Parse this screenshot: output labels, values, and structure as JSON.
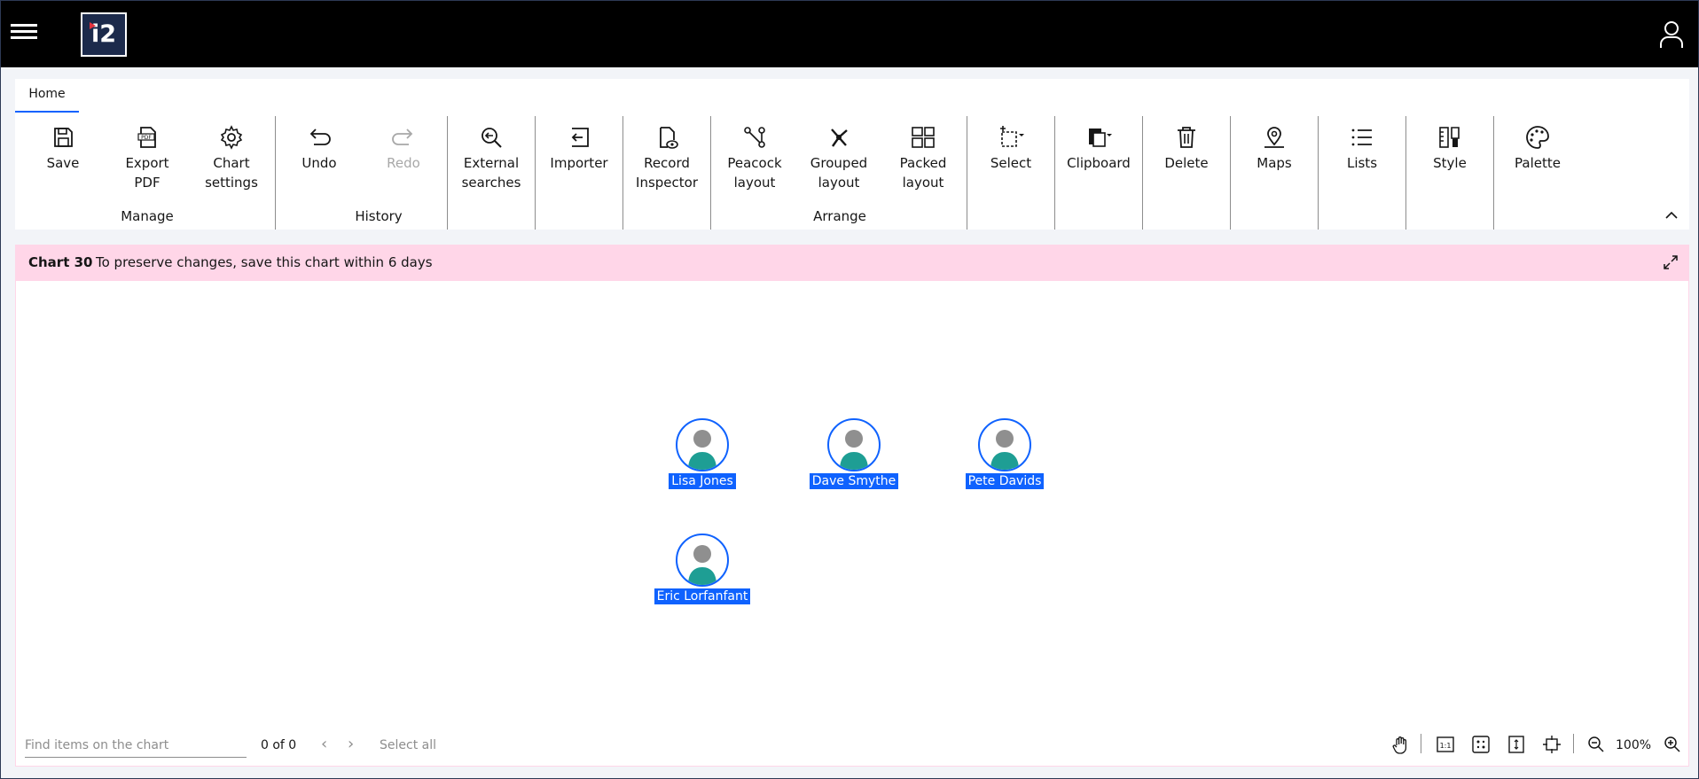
{
  "app": {
    "logo_text": "i2"
  },
  "ribbon": {
    "tab": "Home",
    "buttons": {
      "save": "Save",
      "export_pdf": "Export\nPDF",
      "chart_settings": "Chart\nsettings",
      "undo": "Undo",
      "redo": "Redo",
      "external_searches": "External\nsearches",
      "importer": "Importer",
      "record_inspector": "Record\nInspector",
      "peacock_layout": "Peacock\nlayout",
      "grouped_layout": "Grouped\nlayout",
      "packed_layout": "Packed\nlayout",
      "select": "Select",
      "clipboard": "Clipboard",
      "delete": "Delete",
      "maps": "Maps",
      "lists": "Lists",
      "style": "Style",
      "palette": "Palette"
    },
    "groups": {
      "manage": "Manage",
      "history": "History",
      "arrange": "Arrange"
    }
  },
  "chart": {
    "title": "Chart 30",
    "message": "To preserve changes, save this chart within 6 days",
    "nodes": [
      {
        "label": "Lisa Jones"
      },
      {
        "label": "Dave Smythe"
      },
      {
        "label": "Pete Davids"
      },
      {
        "label": "Eric Lorfanfant"
      }
    ]
  },
  "bottom": {
    "search_placeholder": "Find items on the chart",
    "count": "0 of 0",
    "select_all": "Select all",
    "zoom": "100%"
  },
  "colors": {
    "accent": "#0f62fe",
    "banner": "#ffd6e8",
    "topbar": "#000000"
  }
}
